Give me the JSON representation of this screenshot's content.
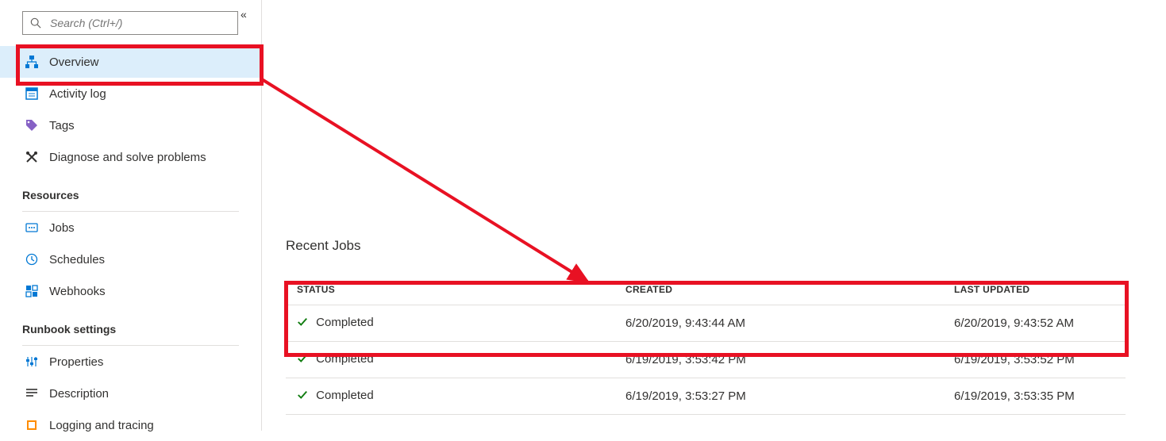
{
  "search": {
    "placeholder": "Search (Ctrl+/)"
  },
  "sidebar": {
    "items": [
      {
        "label": "Overview"
      },
      {
        "label": "Activity log"
      },
      {
        "label": "Tags"
      },
      {
        "label": "Diagnose and solve problems"
      }
    ],
    "section_resources": "Resources",
    "resources": [
      {
        "label": "Jobs"
      },
      {
        "label": "Schedules"
      },
      {
        "label": "Webhooks"
      }
    ],
    "section_runbook": "Runbook settings",
    "runbook": [
      {
        "label": "Properties"
      },
      {
        "label": "Description"
      },
      {
        "label": "Logging and tracing"
      }
    ]
  },
  "main": {
    "title": "Recent Jobs",
    "columns": {
      "status": "STATUS",
      "created": "CREATED",
      "updated": "LAST UPDATED"
    },
    "rows": [
      {
        "status": "Completed",
        "created": "6/20/2019, 9:43:44 AM",
        "updated": "6/20/2019, 9:43:52 AM"
      },
      {
        "status": "Completed",
        "created": "6/19/2019, 3:53:42 PM",
        "updated": "6/19/2019, 3:53:52 PM"
      },
      {
        "status": "Completed",
        "created": "6/19/2019, 3:53:27 PM",
        "updated": "6/19/2019, 3:53:35 PM"
      }
    ]
  }
}
